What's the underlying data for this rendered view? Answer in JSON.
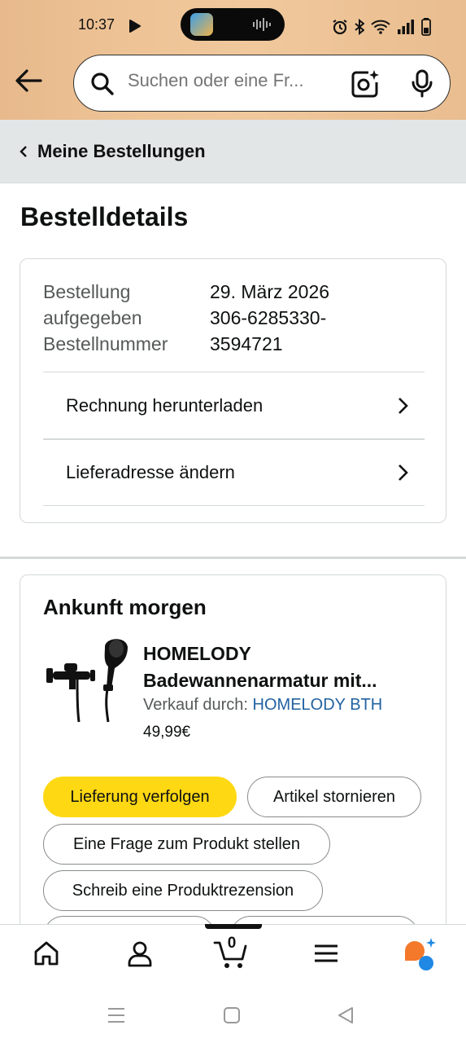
{
  "status_bar": {
    "time": "10:37"
  },
  "search": {
    "placeholder": "Suchen oder eine Fr..."
  },
  "breadcrumb": {
    "label": "Meine Bestellungen"
  },
  "page_title": "Bestelldetails",
  "order_info": {
    "labels": [
      "Bestellung",
      "aufgegeben",
      "Bestellnummer"
    ],
    "values": [
      "29. März 2026",
      "306-6285330-",
      "3594721"
    ]
  },
  "links": {
    "invoice": "Rechnung herunterladen",
    "address": "Lieferadresse ändern"
  },
  "shipment": {
    "arrival": "Ankunft morgen",
    "product_title_line1": "HOMELODY",
    "product_title_line2": "Badewannenarmatur mit...",
    "seller_prefix": "Verkauf durch:",
    "seller_name": "HOMELODY BTH",
    "price": "49,99€"
  },
  "actions": {
    "track": "Lieferung verfolgen",
    "cancel": "Artikel stornieren",
    "question": "Eine Frage zum Produkt stellen",
    "review": "Schreib eine Produktrezension"
  },
  "bottom_nav": {
    "cart_count": "0"
  },
  "colors": {
    "accent_yellow": "#ffd814",
    "link_blue": "#2162a1",
    "header_bg": "#eec496"
  }
}
